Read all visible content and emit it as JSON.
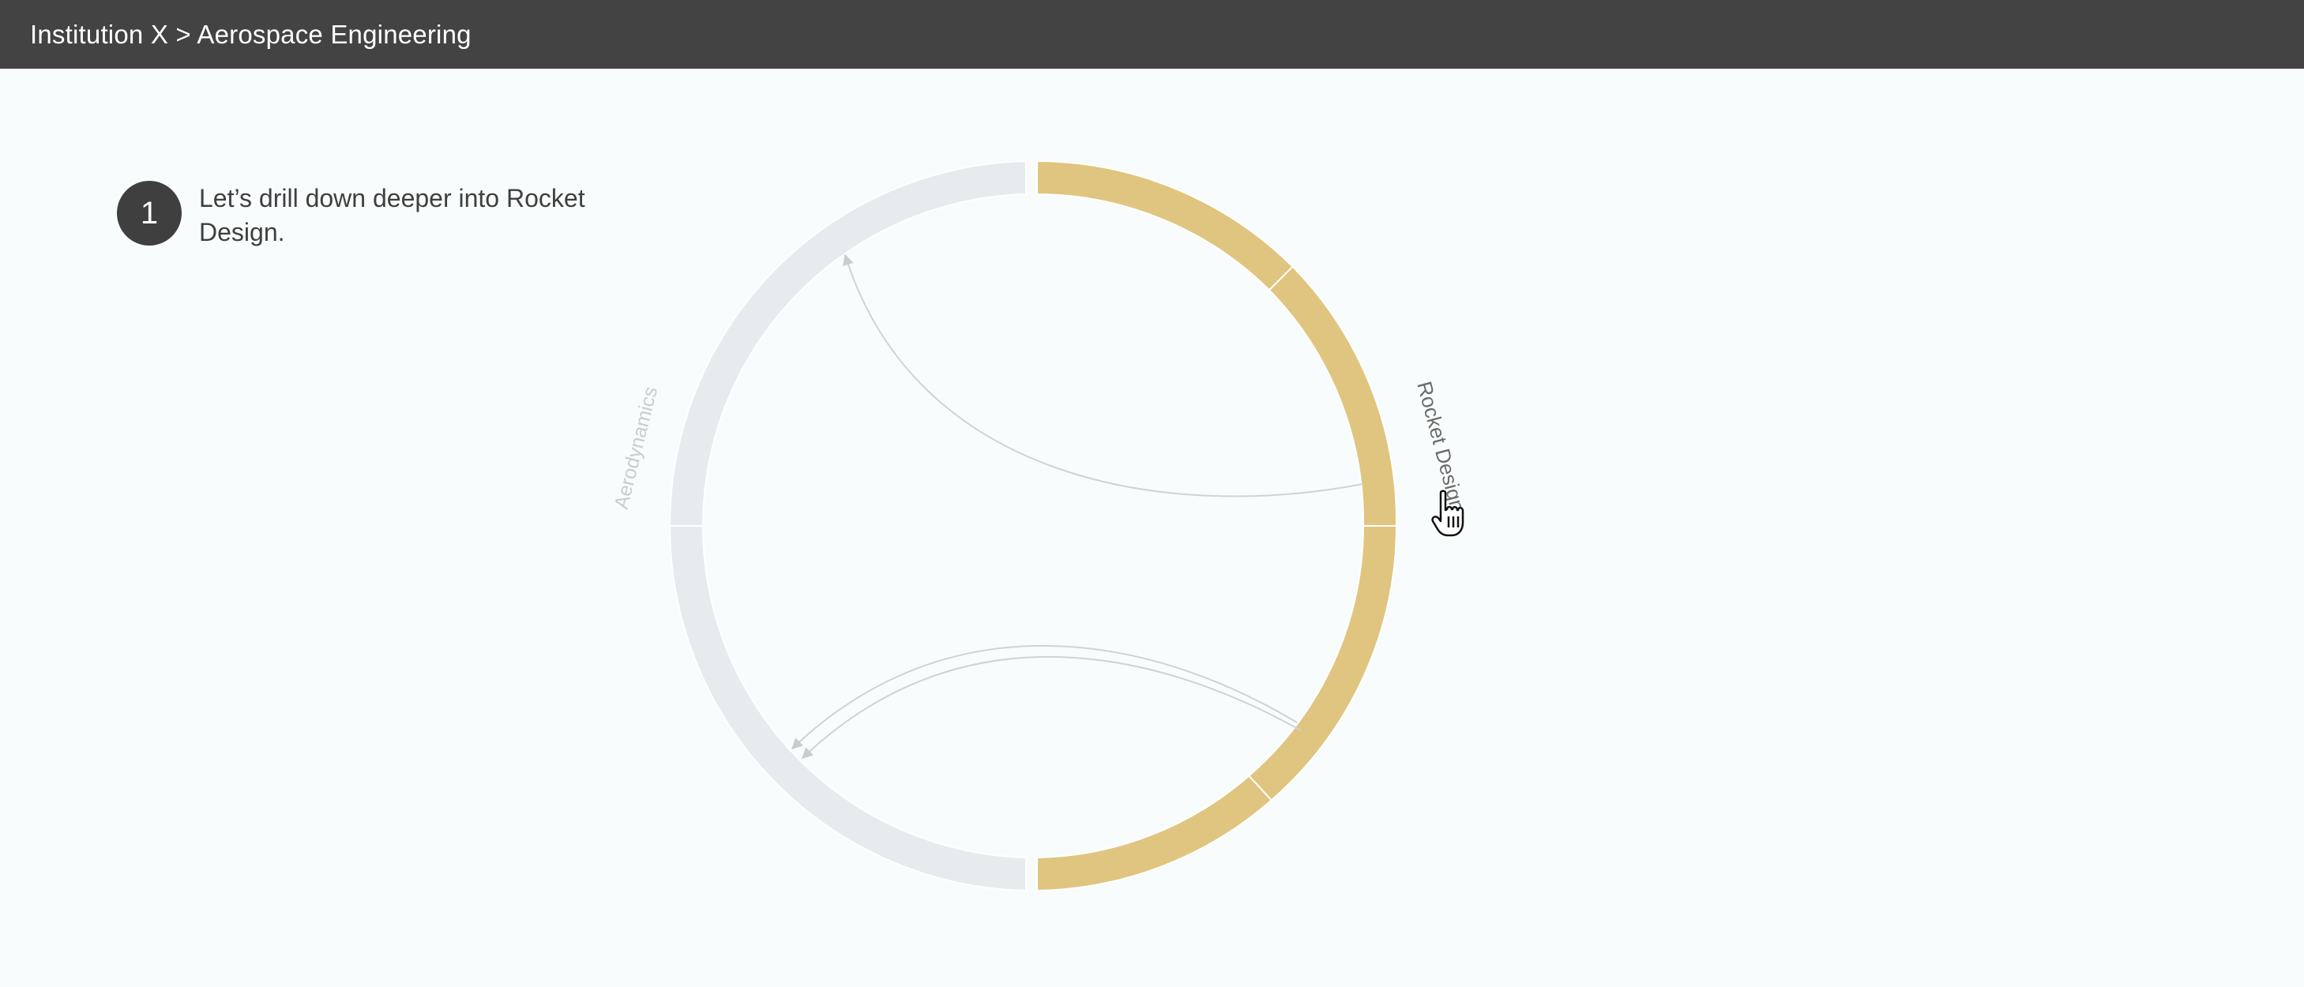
{
  "header": {
    "breadcrumb": "Institution X > Aerospace Engineering"
  },
  "instruction": {
    "step": "1",
    "text": "Let’s drill down deeper into Rocket Design."
  },
  "diagram": {
    "type": "chord",
    "groups": [
      {
        "label": "Rocket Design",
        "color": "#dfc57f",
        "highlighted": true
      },
      {
        "label": "Aerodynamics",
        "color": "#e6ecee",
        "highlighted": false
      }
    ],
    "links": [
      {
        "from": "Rocket Design",
        "to": "Aerodynamics"
      },
      {
        "from": "Rocket Design",
        "to": "Aerodynamics"
      },
      {
        "from": "Rocket Design",
        "to": "Aerodynamics"
      }
    ],
    "link_color": "#cfd3d4",
    "cursor": "hand-pointer-icon"
  }
}
